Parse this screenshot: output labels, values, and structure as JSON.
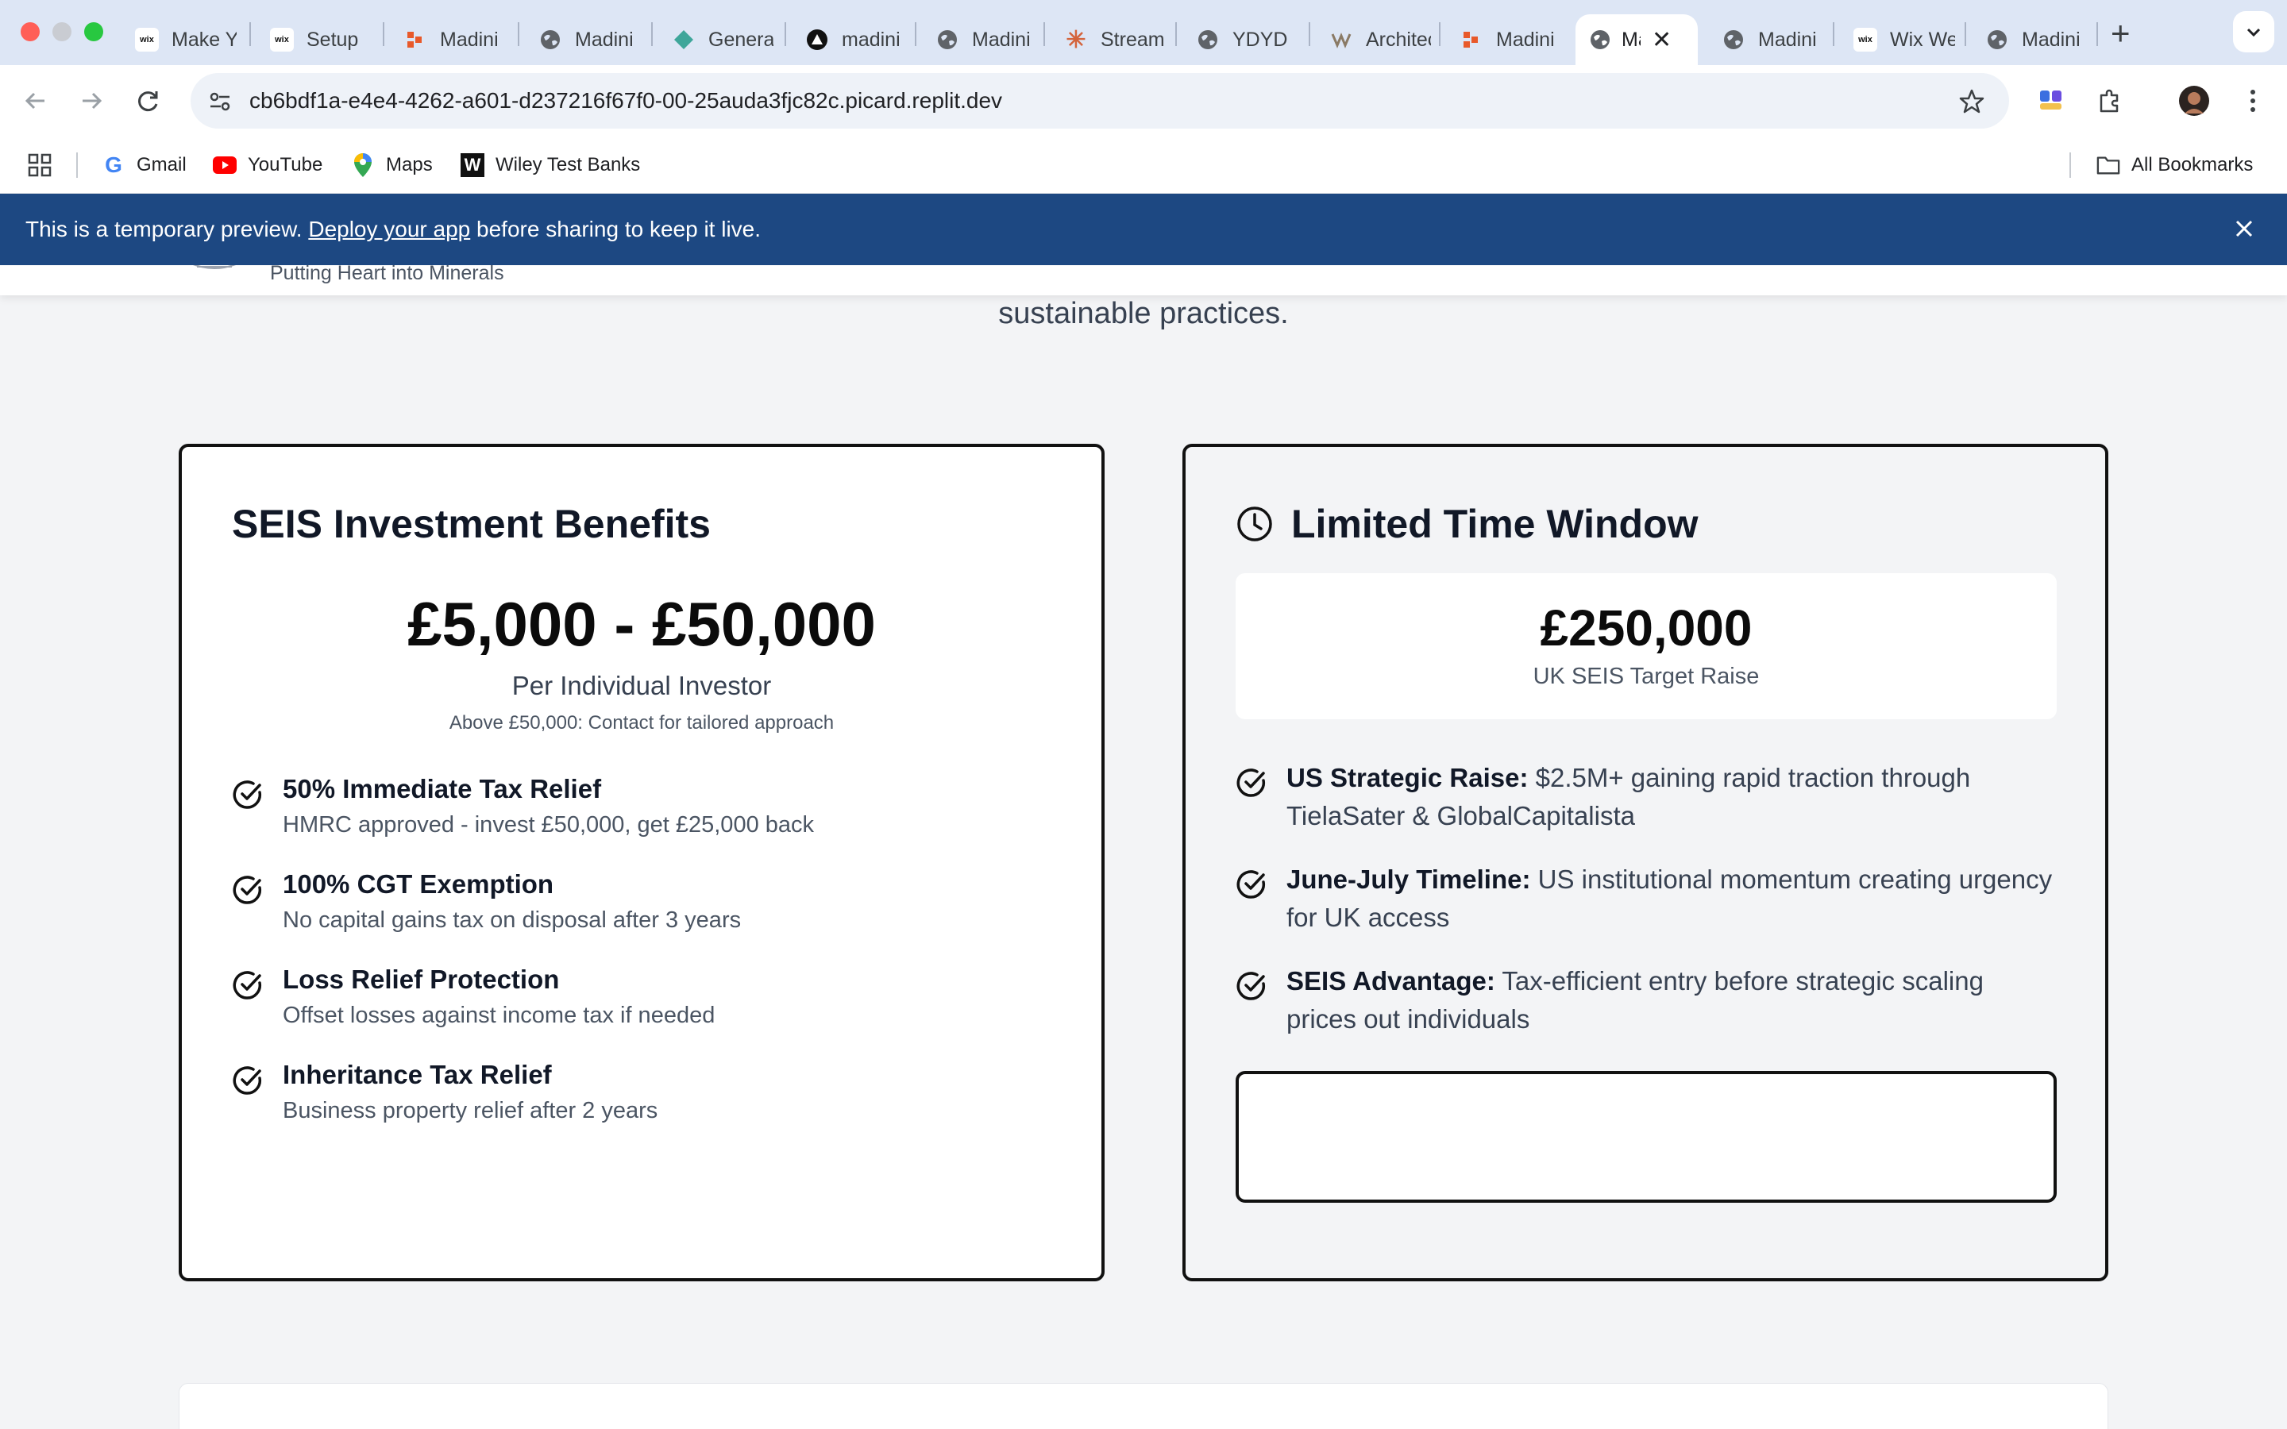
{
  "browser": {
    "tabs": [
      {
        "title": "Make Your Own Website",
        "favicon": "wix"
      },
      {
        "title": "Setup",
        "favicon": "wix"
      },
      {
        "title": "Madini",
        "favicon": "figma"
      },
      {
        "title": "Madini",
        "favicon": "globe"
      },
      {
        "title": "Generate",
        "favicon": "diamond"
      },
      {
        "title": "madini",
        "favicon": "triangle"
      },
      {
        "title": "Madini",
        "favicon": "globe"
      },
      {
        "title": "Stream",
        "favicon": "sparkle"
      },
      {
        "title": "YDYD",
        "favicon": "globe"
      },
      {
        "title": "Architect",
        "favicon": "architect"
      },
      {
        "title": "Madini",
        "favicon": "figma"
      },
      {
        "title": "Madini",
        "favicon": "globe",
        "active": true
      },
      {
        "title": "Madini",
        "favicon": "globe"
      },
      {
        "title": "Wix Website",
        "favicon": "wix"
      },
      {
        "title": "Madini",
        "favicon": "globe"
      }
    ],
    "favicon_text": {
      "wix": "wix"
    },
    "url": "cb6bdf1a-e4e4-4262-a601-d237216f67f0-00-25auda3fjc82c.picard.replit.dev",
    "bookmarks": [
      {
        "label": "Gmail",
        "icon": "google-icon"
      },
      {
        "label": "YouTube",
        "icon": "youtube-icon"
      },
      {
        "label": "Maps",
        "icon": "maps-icon"
      },
      {
        "label": "Wiley Test Banks",
        "icon": "wiley-icon"
      }
    ],
    "all_bookmarks": "All Bookmarks"
  },
  "banner": {
    "prefix": "This is a temporary preview. ",
    "link": "Deploy your app",
    "suffix": " before sharing to keep it live."
  },
  "site": {
    "tagline": "Putting Heart into Minerals",
    "lead_tail": "sustainable practices."
  },
  "seis_card": {
    "title": "SEIS Investment Benefits",
    "range": "£5,000 - £50,000",
    "per": "Per Individual Investor",
    "note": "Above £50,000: Contact for tailored approach",
    "benefits": [
      {
        "title": "50% Immediate Tax Relief",
        "desc": "HMRC approved - invest £50,000, get £25,000 back"
      },
      {
        "title": "100% CGT Exemption",
        "desc": "No capital gains tax on disposal after 3 years"
      },
      {
        "title": "Loss Relief Protection",
        "desc": "Offset losses against income tax if needed"
      },
      {
        "title": "Inheritance Tax Relief",
        "desc": "Business property relief after 2 years"
      }
    ]
  },
  "window_card": {
    "title": "Limited Time Window",
    "amount": "£250,000",
    "amount_label": "UK SEIS Target Raise",
    "points": [
      {
        "strong": "US Strategic Raise:",
        "text": " $2.5M+ gaining rapid traction through TielaSater & GlobalCapitalista"
      },
      {
        "strong": "June-July Timeline:",
        "text": " US institutional momentum creating urgency for UK access"
      },
      {
        "strong": "SEIS Advantage:",
        "text": " Tax-efficient entry before strategic scaling prices out individuals"
      }
    ]
  },
  "colors": {
    "banner_bg": "#1d4882",
    "page_bg": "#f3f4f6",
    "card_border": "#111111"
  }
}
